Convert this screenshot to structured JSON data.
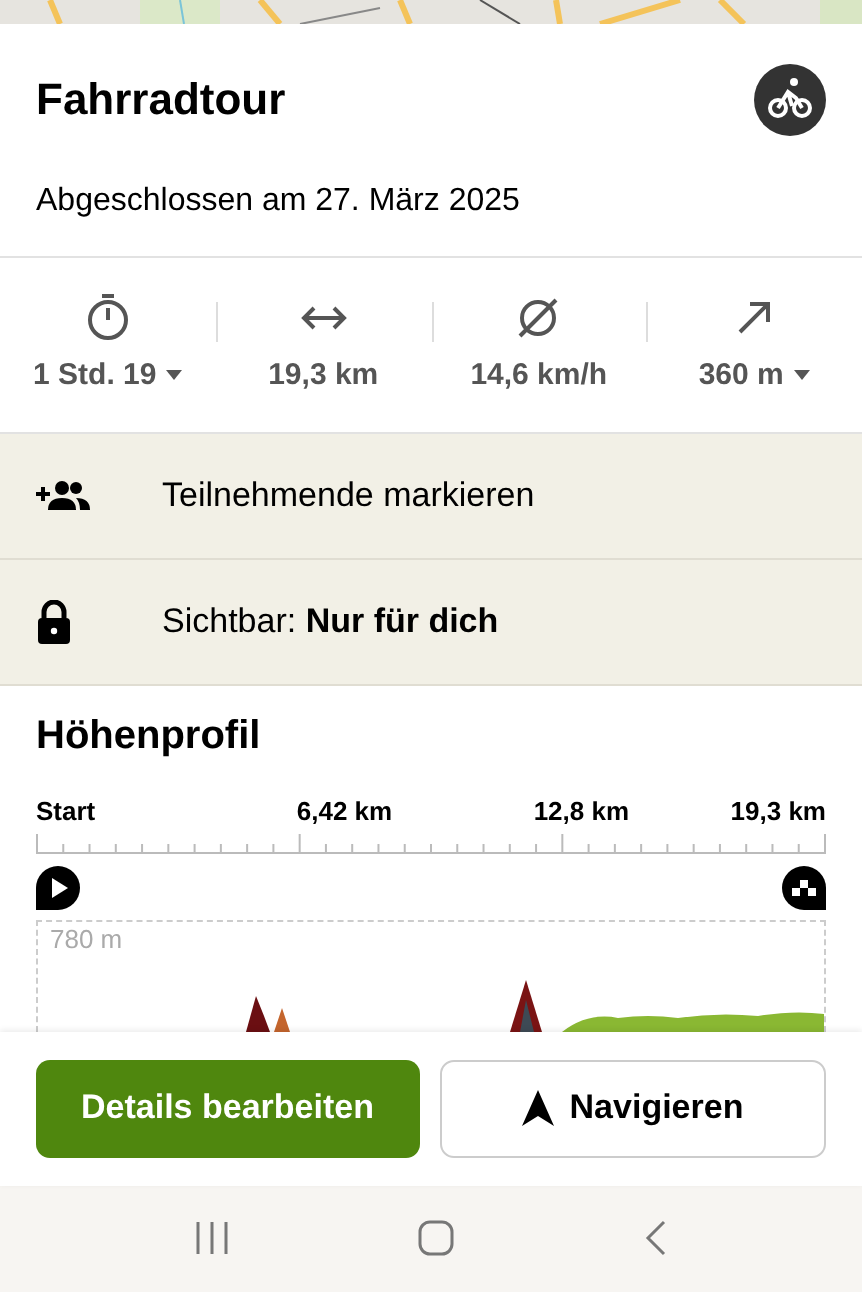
{
  "activity": {
    "title": "Fahrradtour",
    "subtitle": "Abgeschlossen am 27. März 2025",
    "kind": "bike"
  },
  "stats": [
    {
      "kind": "duration",
      "value": "1 Std. 19",
      "dropdown": true
    },
    {
      "kind": "distance",
      "value": "19,3 km",
      "dropdown": false
    },
    {
      "kind": "speed",
      "value": "14,6 km/h",
      "dropdown": false
    },
    {
      "kind": "ascent",
      "value": "360 m",
      "dropdown": true
    }
  ],
  "actions": [
    {
      "kind": "participants",
      "text": "Teilnehmende markieren"
    },
    {
      "kind": "visibility",
      "text": "Sichtbar: **Nur für dich**"
    }
  ],
  "elevation": {
    "title": "Höhenprofil",
    "x_labels": [
      "Start",
      "6,42 km",
      "12,8 km",
      "19,3 km"
    ],
    "y_label": "780 m"
  },
  "buttons": [
    {
      "kind": "primary",
      "label": "Details bearbeiten"
    },
    {
      "kind": "navigate",
      "label": "Navigieren"
    }
  ]
}
